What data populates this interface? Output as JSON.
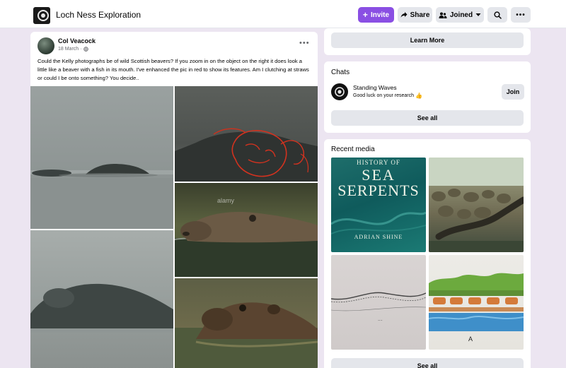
{
  "header": {
    "group_name": "Loch Ness Exploration",
    "invite_label": "Invite",
    "share_label": "Share",
    "joined_label": "Joined"
  },
  "post": {
    "author": "Col Veacock",
    "date": "18 March",
    "text": "Could the Kelly photographs be of wild Scottish beavers? If you zoom in on the object on the right it does look a little like a beaver with a fish in its mouth. I've enhanced the pic in red to show its features. Am I clutching at straws or could I be onto something? You decide..",
    "watermark": "alamy"
  },
  "sidebar": {
    "learn_more_label": "Learn More",
    "chats": {
      "title": "Chats",
      "items": [
        {
          "name": "Standing Waves",
          "preview": "Good luck on your research",
          "join_label": "Join"
        }
      ],
      "see_all_label": "See all"
    },
    "recent_media": {
      "title": "Recent media",
      "book_title_line1": "HISTORY OF",
      "book_title_line2": "SEA",
      "book_title_line3": "SERPENTS",
      "book_author": "ADRIAN SHINE",
      "drawing_letter": "A",
      "see_all_label": "See all"
    }
  },
  "colors": {
    "accent": "#8a4fe3",
    "page_background": "#ece5f1"
  }
}
